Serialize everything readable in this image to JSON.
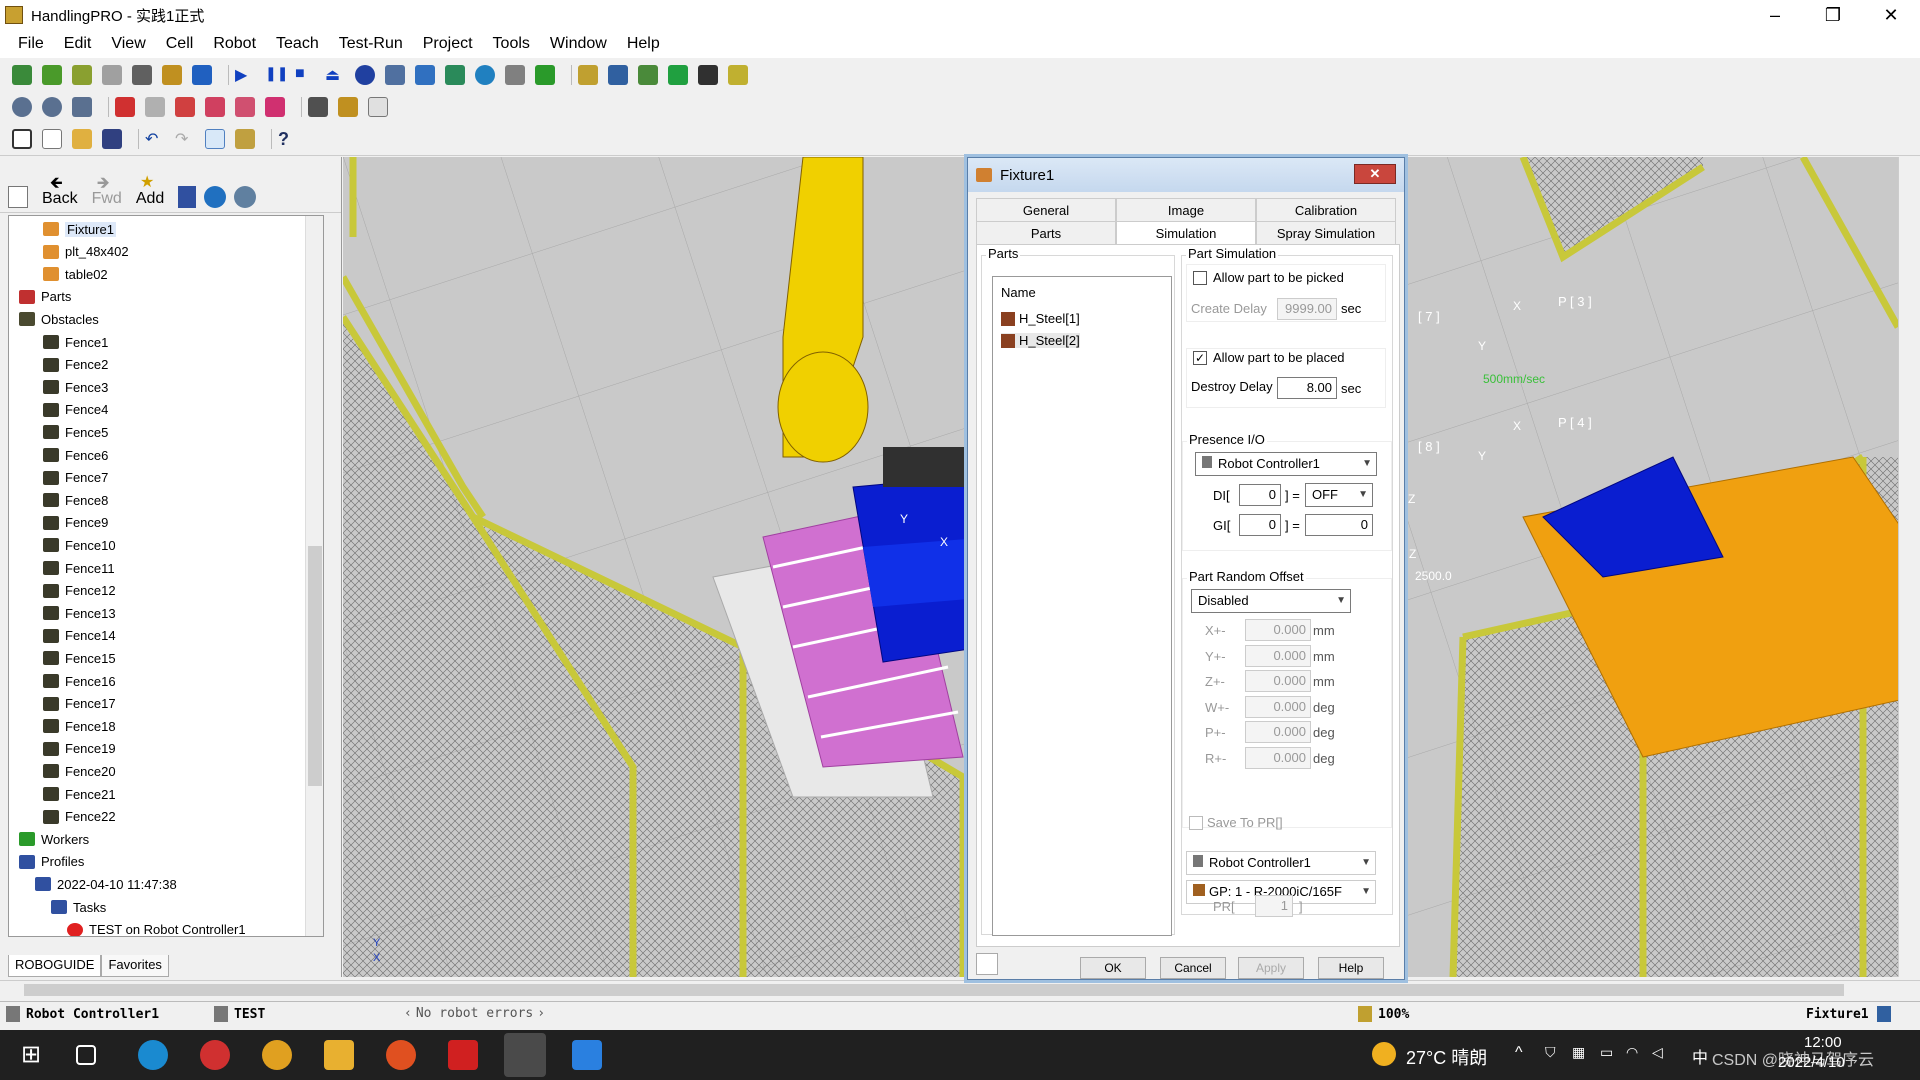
{
  "window": {
    "title": "HandlingPRO - 实践1正式",
    "minimize": "–",
    "maximize": "❐",
    "close": "✕"
  },
  "menu": [
    "File",
    "Edit",
    "View",
    "Cell",
    "Robot",
    "Teach",
    "Test-Run",
    "Project",
    "Tools",
    "Window",
    "Help"
  ],
  "nav": {
    "back": "Back",
    "fwd": "Fwd",
    "add": "Add"
  },
  "tree": [
    {
      "label": "Fixture1",
      "indent": 3,
      "icon": "fixture-icon",
      "selected": true
    },
    {
      "label": "plt_48x402",
      "indent": 3,
      "icon": "fixture-icon"
    },
    {
      "label": "table02",
      "indent": 3,
      "icon": "fixture-icon"
    },
    {
      "label": "Parts",
      "indent": 0,
      "icon": "parts-icon"
    },
    {
      "label": "Obstacles",
      "indent": 0,
      "icon": "obstacles-icon"
    },
    {
      "label": "Fence1",
      "indent": 3,
      "icon": "fence-icon"
    },
    {
      "label": "Fence2",
      "indent": 3,
      "icon": "fence-icon"
    },
    {
      "label": "Fence3",
      "indent": 3,
      "icon": "fence-icon"
    },
    {
      "label": "Fence4",
      "indent": 3,
      "icon": "fence-icon"
    },
    {
      "label": "Fence5",
      "indent": 3,
      "icon": "fence-icon"
    },
    {
      "label": "Fence6",
      "indent": 3,
      "icon": "fence-icon"
    },
    {
      "label": "Fence7",
      "indent": 3,
      "icon": "fence-icon"
    },
    {
      "label": "Fence8",
      "indent": 3,
      "icon": "fence-icon"
    },
    {
      "label": "Fence9",
      "indent": 3,
      "icon": "fence-icon"
    },
    {
      "label": "Fence10",
      "indent": 3,
      "icon": "fence-icon"
    },
    {
      "label": "Fence11",
      "indent": 3,
      "icon": "fence-icon"
    },
    {
      "label": "Fence12",
      "indent": 3,
      "icon": "fence-icon"
    },
    {
      "label": "Fence13",
      "indent": 3,
      "icon": "fence-icon"
    },
    {
      "label": "Fence14",
      "indent": 3,
      "icon": "fence-icon"
    },
    {
      "label": "Fence15",
      "indent": 3,
      "icon": "fence-icon"
    },
    {
      "label": "Fence16",
      "indent": 3,
      "icon": "fence-icon"
    },
    {
      "label": "Fence17",
      "indent": 3,
      "icon": "fence-icon"
    },
    {
      "label": "Fence18",
      "indent": 3,
      "icon": "fence-icon"
    },
    {
      "label": "Fence19",
      "indent": 3,
      "icon": "fence-icon"
    },
    {
      "label": "Fence20",
      "indent": 3,
      "icon": "fence-icon"
    },
    {
      "label": "Fence21",
      "indent": 3,
      "icon": "fence-icon"
    },
    {
      "label": "Fence22",
      "indent": 3,
      "icon": "fence-icon"
    },
    {
      "label": "Workers",
      "indent": 0,
      "icon": "workers-icon"
    },
    {
      "label": "Profiles",
      "indent": 0,
      "icon": "profiles-icon"
    },
    {
      "label": "2022-04-10 11:47:38",
      "indent": 2,
      "icon": "profile-icon"
    },
    {
      "label": "Tasks",
      "indent": 4,
      "icon": "tasks-icon"
    },
    {
      "label": "TEST on Robot Controller1",
      "indent": 6,
      "icon": "error-icon"
    }
  ],
  "left_tabs": [
    "ROBOGUIDE",
    "Favorites"
  ],
  "viewport_labels": [
    "P [ 3 ]",
    "P [ 4 ]",
    "[ 8 ]",
    "[ 7 ]",
    "500mm/sec",
    "X",
    "Y",
    "Z",
    "X",
    "Y",
    "X",
    "Y",
    "Z",
    "2500.0",
    "X",
    "Y"
  ],
  "dialog": {
    "title": "Fixture1",
    "close": "✕",
    "tabs_top": [
      "General",
      "Image",
      "Calibration"
    ],
    "tabs_bottom": [
      "Parts",
      "Simulation",
      "Spray Simulation"
    ],
    "active_tab": "Simulation",
    "parts_group": "Parts",
    "parts_header": "Name",
    "parts": [
      "H_Steel[1]",
      "H_Steel[2]"
    ],
    "part_sim_group": "Part Simulation",
    "allow_picked": "Allow part to be picked",
    "allow_picked_checked": false,
    "create_delay_label": "Create Delay",
    "create_delay_value": "9999.00",
    "unit_sec": "sec",
    "allow_placed": "Allow part to be placed",
    "allow_placed_checked": true,
    "check_mark": "✓",
    "destroy_delay_label": "Destroy Delay",
    "destroy_delay_value": "8.00",
    "presence_group": "Presence I/O",
    "presence_controller": "Robot Controller1",
    "di_label": "DI[",
    "di_value": "0",
    "bracket_eq": "] =",
    "di_state": "OFF",
    "gi_label": "GI[",
    "gi_value": "0",
    "gi_state": "0",
    "random_group": "Part Random Offset",
    "random_mode": "Disabled",
    "offsets": [
      {
        "label": "X+-",
        "value": "0.000",
        "unit": "mm"
      },
      {
        "label": "Y+-",
        "value": "0.000",
        "unit": "mm"
      },
      {
        "label": "Z+-",
        "value": "0.000",
        "unit": "mm"
      },
      {
        "label": "W+-",
        "value": "0.000",
        "unit": "deg"
      },
      {
        "label": "P+-",
        "value": "0.000",
        "unit": "deg"
      },
      {
        "label": "R+-",
        "value": "0.000",
        "unit": "deg"
      }
    ],
    "save_pr": "Save To PR[]",
    "controller2": "Robot Controller1",
    "group": "GP: 1 - R-2000iC/165F",
    "pr_label": "PR[",
    "pr_value": "1",
    "pr_close": "]",
    "buttons": [
      "OK",
      "Cancel",
      "Apply",
      "Help"
    ]
  },
  "status": {
    "controller": "Robot Controller1",
    "program": "TEST",
    "errors": "No robot errors",
    "zoom": "100%",
    "selection": "Fixture1"
  },
  "taskbar": {
    "weather": "27°C 晴朗",
    "ime": "中",
    "time": "12:00",
    "date": "2022/4/10",
    "watermark": "CSDN @晓神马驾序云"
  },
  "colors": {
    "fence": "#c8c83a",
    "robot": "#f0d000",
    "blue_part": "#0a1ed0",
    "pallet": "#d070d0",
    "orange_fixture": "#f0a010",
    "arrow": "#e02020"
  }
}
